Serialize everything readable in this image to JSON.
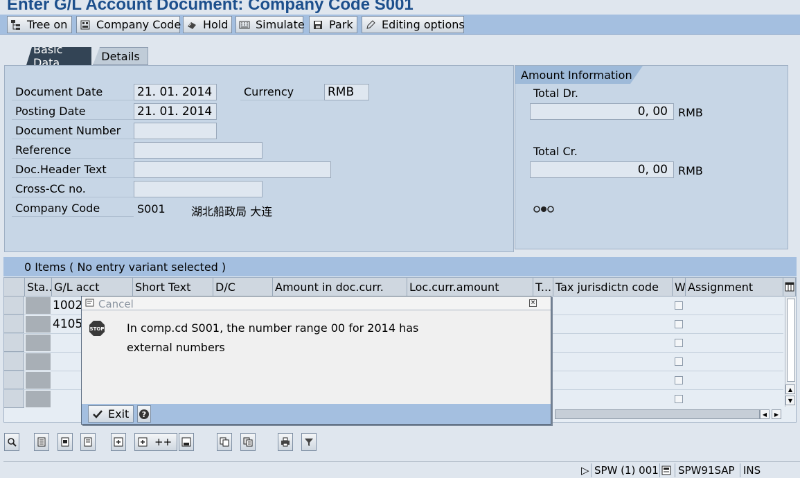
{
  "window": {
    "title": "Enter G/L Account Document: Company Code S001"
  },
  "toolbar": [
    {
      "label": "Tree on",
      "icon": "tree-icon"
    },
    {
      "label": "Company Code",
      "icon": "company-code-icon"
    },
    {
      "label": "Hold",
      "icon": "hold-icon"
    },
    {
      "label": "Simulate",
      "icon": "simulate-icon"
    },
    {
      "label": "Park",
      "icon": "park-icon"
    },
    {
      "label": "Editing options",
      "icon": "pencil-icon"
    }
  ],
  "tabs": [
    {
      "label": "Basic Data",
      "active": true
    },
    {
      "label": "Details",
      "active": false
    }
  ],
  "header": {
    "document_date_label": "Document Date",
    "document_date": "21. 01. 2014",
    "currency_label": "Currency",
    "currency": "RMB",
    "posting_date_label": "Posting Date",
    "posting_date": "21. 01. 2014",
    "document_number_label": "Document Number",
    "document_number": "",
    "reference_label": "Reference",
    "reference": "",
    "doc_header_text_label": "Doc.Header Text",
    "doc_header_text": "",
    "cross_cc_label": "Cross-CC no.",
    "cross_cc": "",
    "company_code_label": "Company Code",
    "company_code": "S001",
    "company_name": "湖北船政局 大连"
  },
  "amount_info": {
    "title": "Amount Information",
    "total_dr_label": "Total Dr.",
    "total_dr": "0, 00",
    "total_dr_currency": "RMB",
    "total_cr_label": "Total Cr.",
    "total_cr": "0, 00",
    "total_cr_currency": "RMB",
    "status_icon": "traffic-light-icon"
  },
  "items": {
    "summary": "0 Items ( No entry variant selected )",
    "columns": [
      "Sta...",
      "G/L acct",
      "Short Text",
      "D/C",
      "Amount in doc.curr.",
      "Loc.curr.amount",
      "T...",
      "Tax jurisdictn code",
      "W",
      "Assignment"
    ],
    "rows": [
      {
        "gl_acct": "1002"
      },
      {
        "gl_acct": "4105"
      },
      {
        "gl_acct": ""
      },
      {
        "gl_acct": ""
      },
      {
        "gl_acct": ""
      },
      {
        "gl_acct": ""
      }
    ]
  },
  "dialog": {
    "title": "Cancel",
    "message_line1": "In comp.cd S001, the number range 00 for 2014 has",
    "message_line2": "external numbers",
    "exit_label": "Exit",
    "icon": "stop-icon"
  },
  "item_toolbar": {
    "add_label": "++"
  },
  "status_bar": {
    "session": "SPW (1) 001",
    "server": "SPW91SAP",
    "mode": "INS"
  },
  "colors": {
    "title": "#1c4f8c",
    "toolbar": "#a4bfe0",
    "panel": "#c7d6e6"
  }
}
